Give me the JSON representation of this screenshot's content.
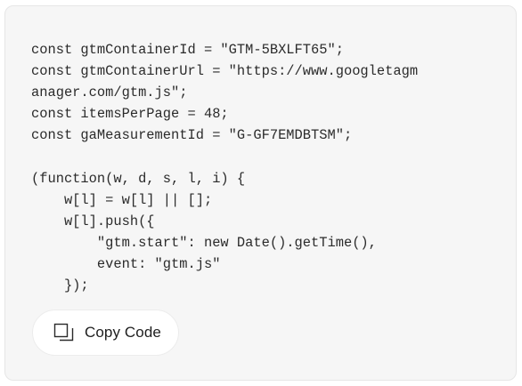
{
  "code_block": {
    "lines": [
      "const gtmContainerId = \"GTM-5BXLFT65\";",
      "const gtmContainerUrl = \"https://www.googletagm",
      "anager.com/gtm.js\";",
      "const itemsPerPage = 48;",
      "const gaMeasurementId = \"G-GF7EMDBTSM\";",
      "",
      "(function(w, d, s, l, i) {",
      "    w[l] = w[l] || [];",
      "    w[l].push({",
      "        \"gtm.start\": new Date().getTime(),",
      "        event: \"gtm.js\"",
      "    });"
    ]
  },
  "copy_button": {
    "label": "Copy Code",
    "icon": "copy-icon"
  }
}
